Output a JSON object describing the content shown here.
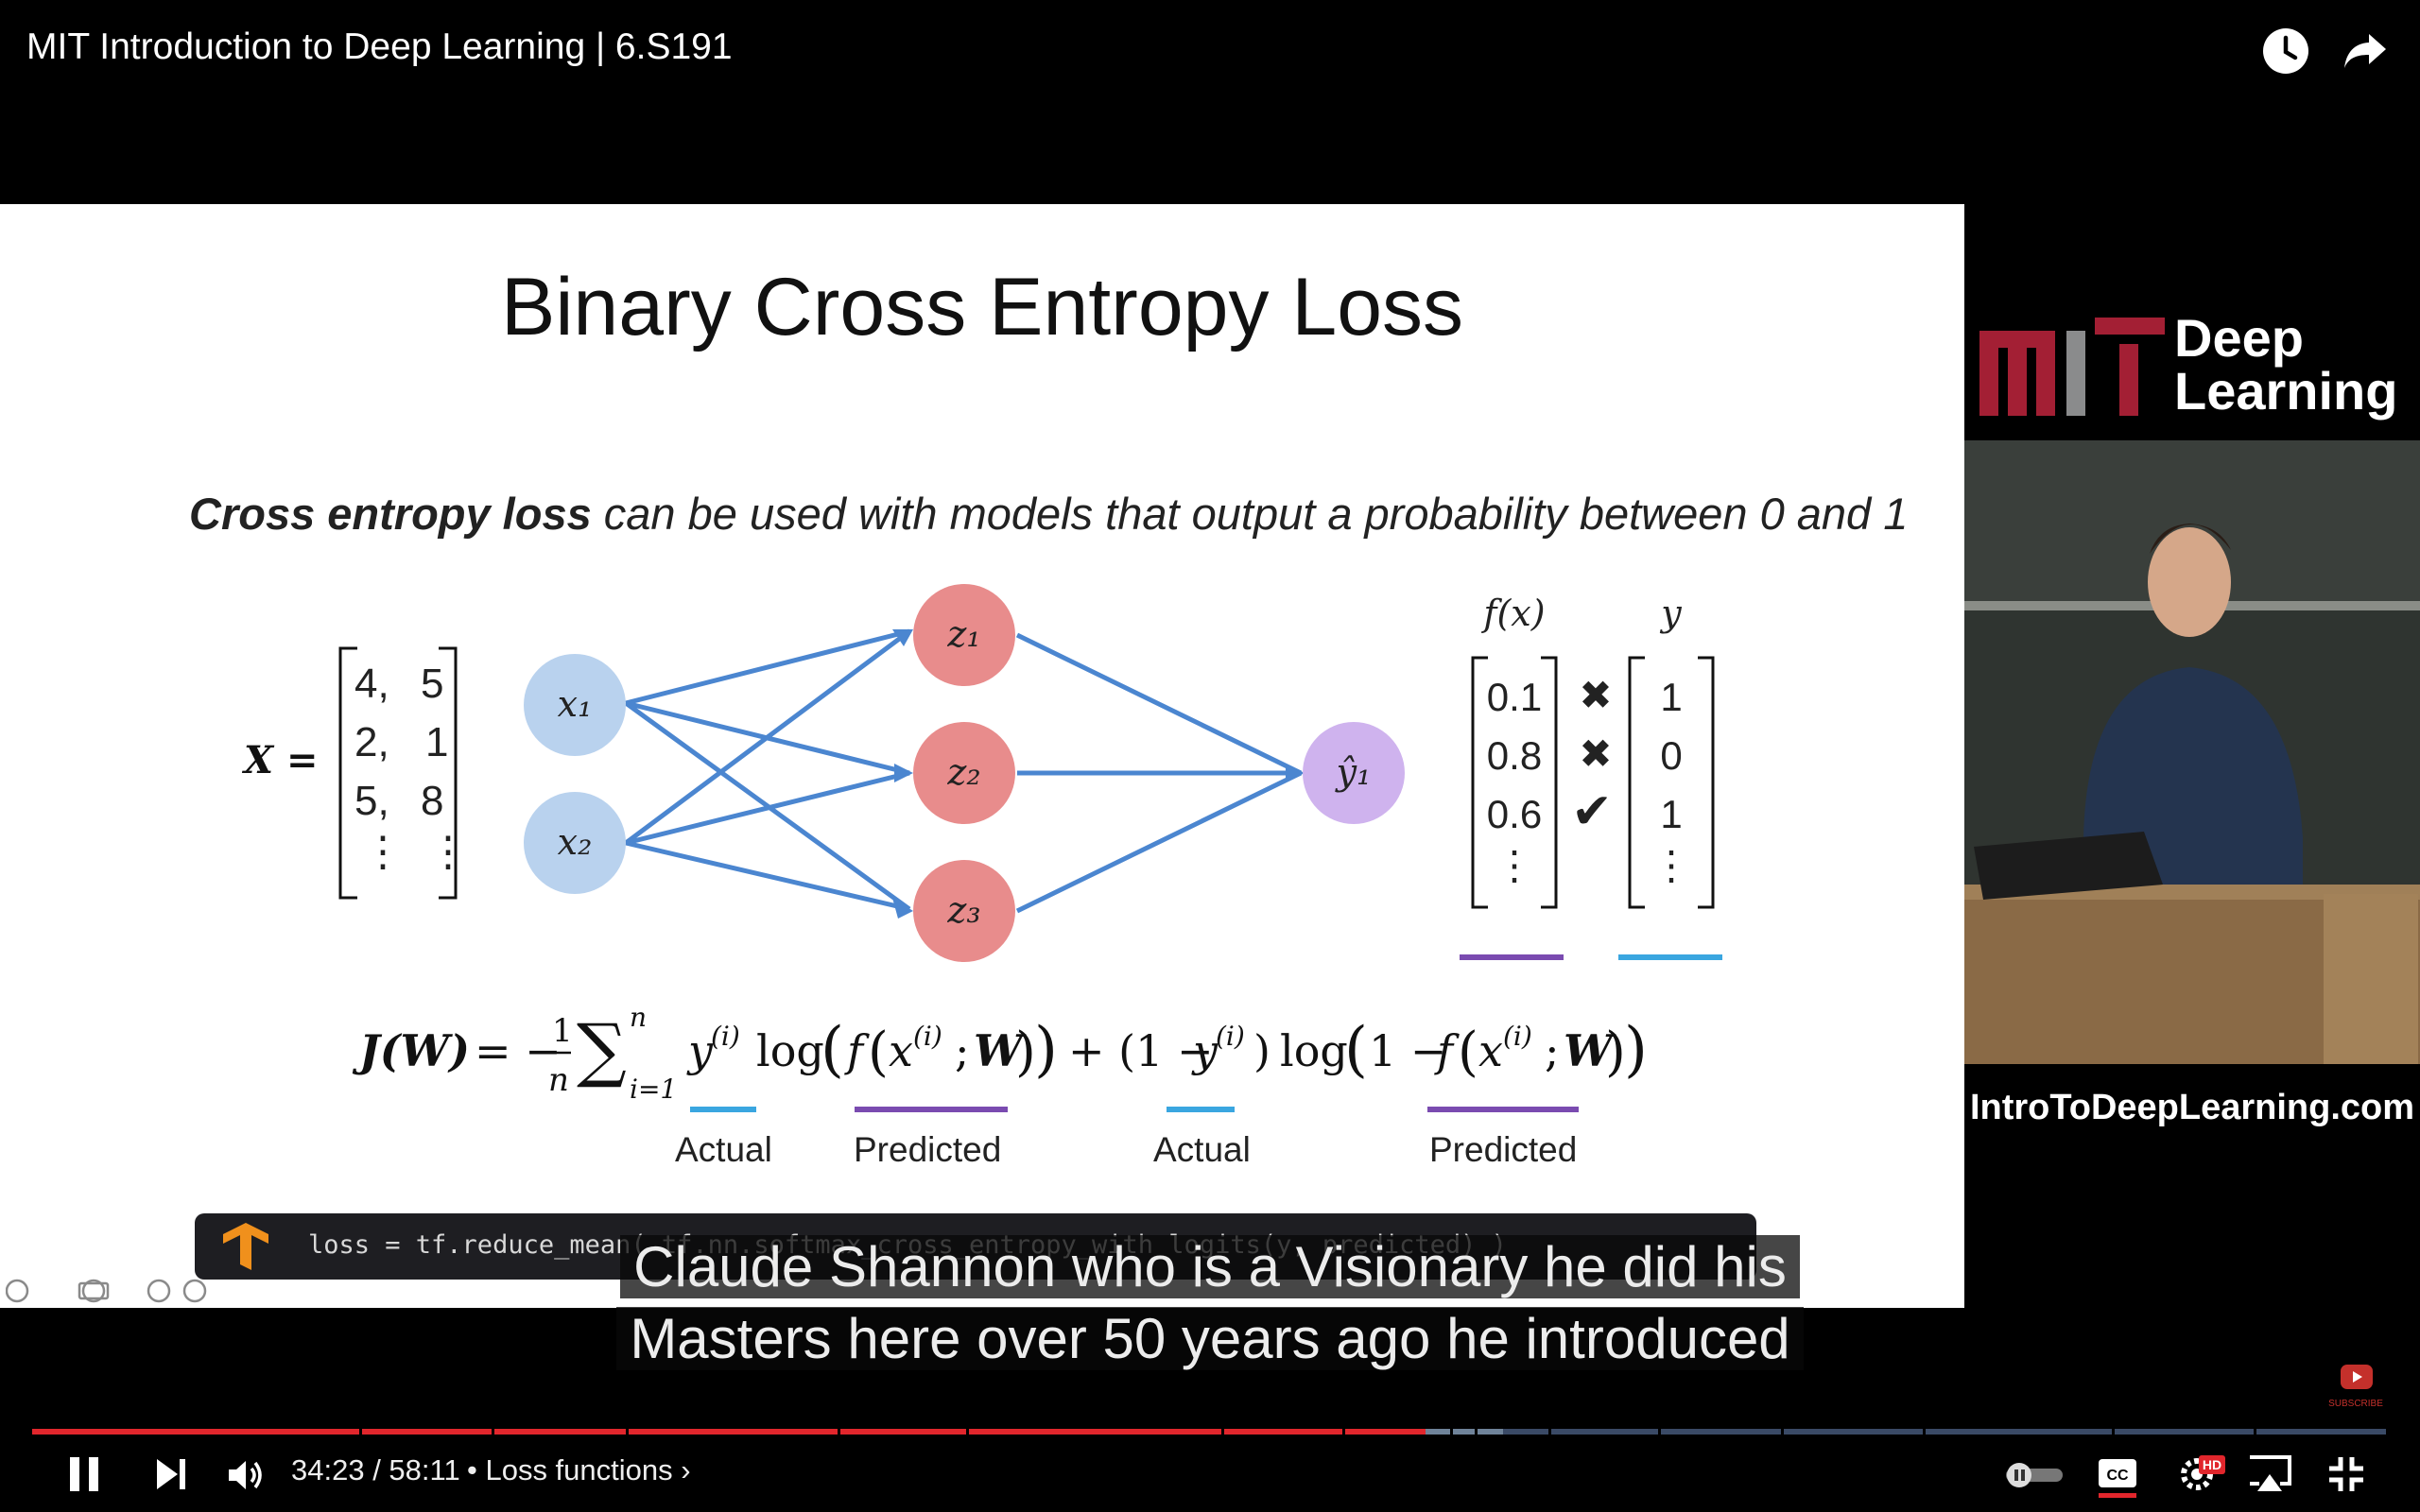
{
  "header": {
    "title": "MIT Introduction to Deep Learning | 6.S191",
    "watch_later_icon": "clock-icon",
    "share_icon": "share-arrow-icon"
  },
  "slide": {
    "title": "Binary Cross Entropy Loss",
    "subtitle_bold": "Cross entropy loss",
    "subtitle_rest": " can be used with models that output a probability between 0 and 1",
    "matrix_label": "X =",
    "matrix_rows": [
      [
        "4,",
        "5"
      ],
      [
        "2,",
        "1"
      ],
      [
        "5,",
        "8"
      ],
      [
        "⋮",
        "⋮"
      ]
    ],
    "input_nodes": [
      "x₁",
      "x₂"
    ],
    "hidden_nodes": [
      "z₁",
      "z₂",
      "z₃"
    ],
    "output_node": "ŷ₁",
    "fx_header": "f(x)",
    "y_header": "y",
    "fx_values": [
      "0.1",
      "0.8",
      "0.6",
      "⋮"
    ],
    "marks": [
      "✖",
      "✖",
      "✔"
    ],
    "y_values": [
      "1",
      "0",
      "1",
      "⋮"
    ],
    "annotations": [
      "Actual",
      "Predicted",
      "Actual",
      "Predicted"
    ],
    "code": "loss = tf.reduce_mean( tf.nn.softmax_cross_entropy_with_logits(y, predicted) )"
  },
  "speaker_panel": {
    "brand_line1": "Deep",
    "brand_line2": "Learning",
    "website": "IntroToDeepLearning.com"
  },
  "captions": {
    "line1": "Claude Shannon who is a Visionary he did his",
    "line2": "Masters here over 50 years ago he introduced"
  },
  "player": {
    "time": "34:23 / 58:11",
    "chapter": "• Loss functions ›",
    "progress_fraction": 0.592,
    "buffered_fraction": 0.625,
    "colors": {
      "played": "#e1262c",
      "buffered": "#6f8399",
      "track": "#3a4a66",
      "accent_blue": "#5b8fd6"
    }
  }
}
